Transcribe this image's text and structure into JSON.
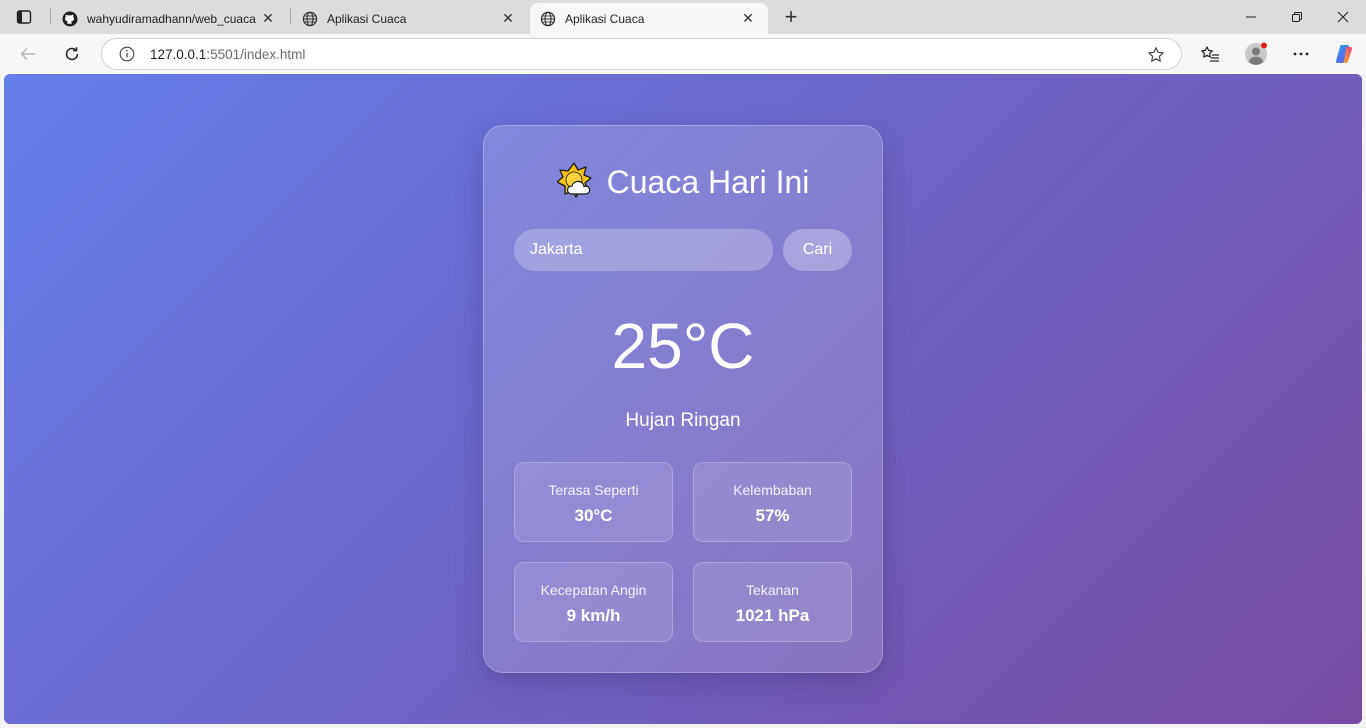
{
  "browser": {
    "tabs": [
      {
        "title": "wahyudiramadhann/web_cuaca",
        "icon": "github-icon",
        "active": false
      },
      {
        "title": "Aplikasi Cuaca",
        "icon": "globe-icon",
        "active": false
      },
      {
        "title": "Aplikasi Cuaca",
        "icon": "globe-icon",
        "active": true
      }
    ],
    "new_tab_label": "+",
    "url_host": "127.0.0.1",
    "url_rest": ":5501/index.html"
  },
  "app": {
    "title": "Cuaca Hari Ini",
    "title_icon": "sun-behind-cloud-icon",
    "search": {
      "value": "Jakarta",
      "button_label": "Cari"
    },
    "temperature": "25°C",
    "description": "Hujan Ringan",
    "details": [
      {
        "label": "Terasa Seperti",
        "value": "30°C"
      },
      {
        "label": "Kelembaban",
        "value": "57%"
      },
      {
        "label": "Kecepatan Angin",
        "value": "9 km/h"
      },
      {
        "label": "Tekanan",
        "value": "1021 hPa"
      }
    ]
  },
  "colors": {
    "gradient_start": "#667eea",
    "gradient_end": "#764ba2"
  }
}
